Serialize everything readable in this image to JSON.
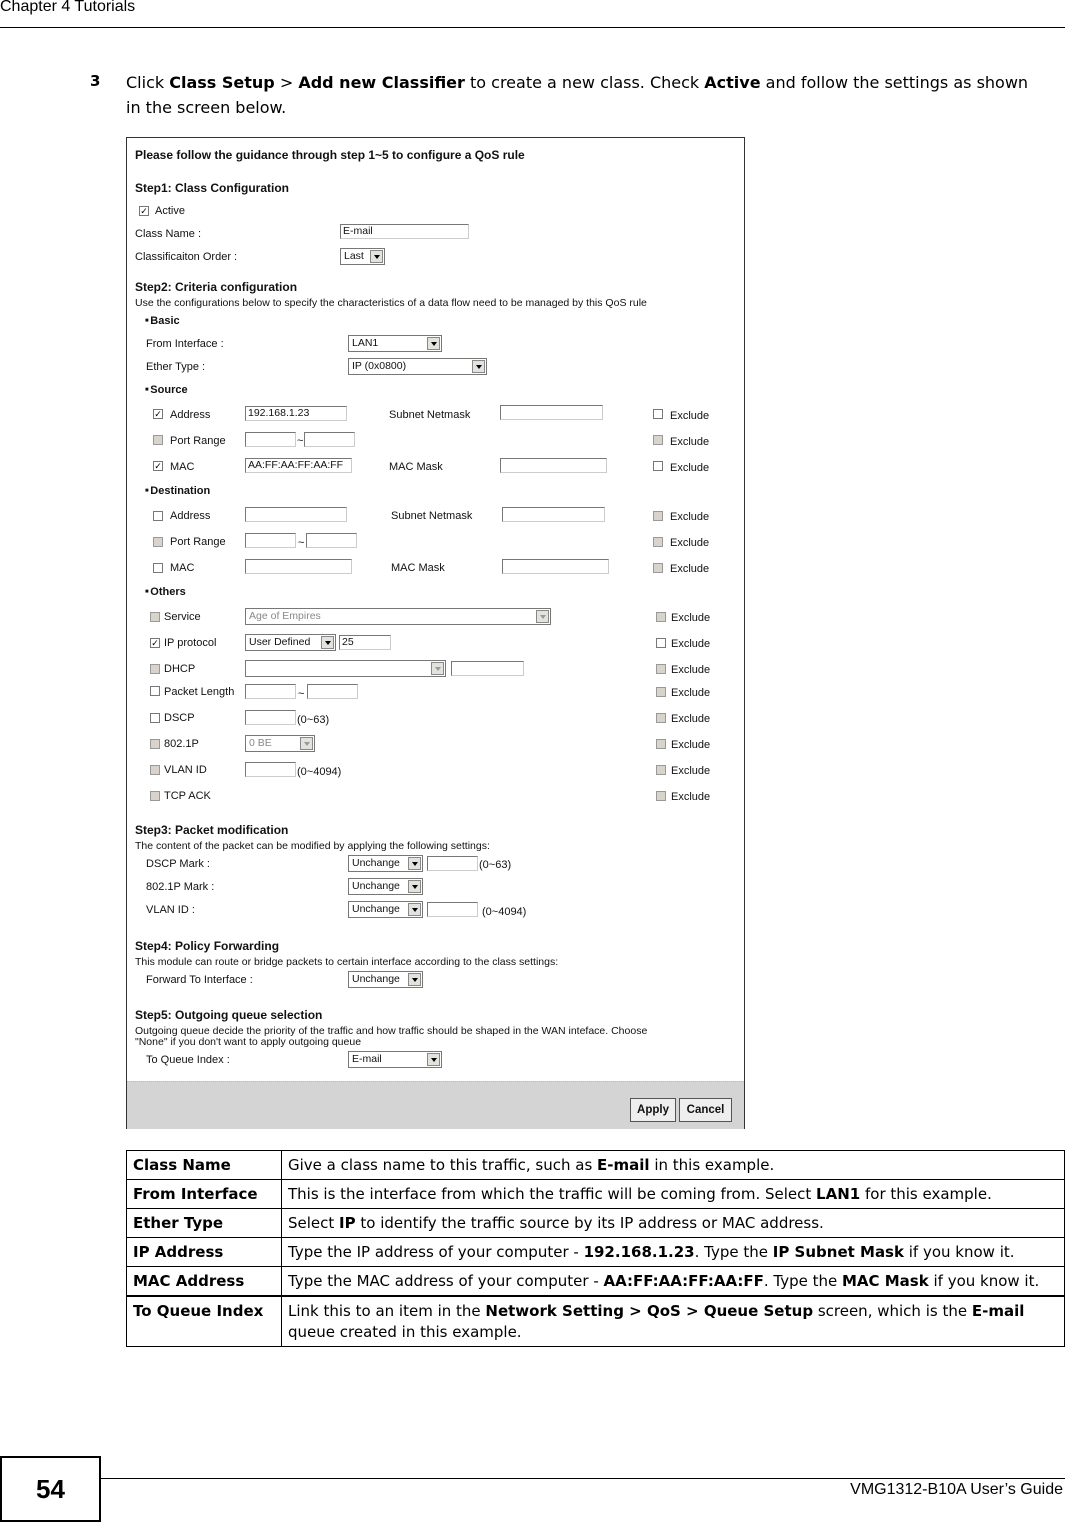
{
  "header": {
    "chapter": "Chapter 4 Tutorials"
  },
  "instruction": {
    "number": "3",
    "parts": [
      {
        "t": "Click ",
        "b": false
      },
      {
        "t": "Class Setup",
        "b": true
      },
      {
        "t": " > ",
        "b": false
      },
      {
        "t": "Add new Classifier",
        "b": true
      },
      {
        "t": " to create a new class. Check ",
        "b": false
      },
      {
        "t": "Active",
        "b": true
      },
      {
        "t": " and follow the settings as shown in the screen below.",
        "b": false
      }
    ]
  },
  "form": {
    "guidance": "Please follow the guidance through step 1~5 to configure a QoS rule",
    "step1": {
      "title": "Step1: Class Configuration",
      "active_label": "Active",
      "active_checked": true,
      "class_name_label": "Class Name :",
      "class_name_value": "E-mail",
      "order_label": "Classificaiton Order :",
      "order_value": "Last"
    },
    "step2": {
      "title": "Step2: Criteria configuration",
      "desc": "Use the configurations below to specify the characteristics of a data flow need to be managed by this QoS rule",
      "basic": {
        "title": "Basic",
        "from_interface_label": "From Interface :",
        "from_interface_value": "LAN1",
        "ether_type_label": "Ether Type :",
        "ether_type_value": "IP (0x0800)"
      },
      "source": {
        "title": "Source",
        "address_label": "Address",
        "address_value": "192.168.1.23",
        "subnet_label": "Subnet Netmask",
        "port_range_label": "Port Range",
        "tilde": "~",
        "mac_label": "MAC",
        "mac_value": "AA:FF:AA:FF:AA:FF",
        "mac_mask_label": "MAC Mask"
      },
      "destination": {
        "title": "Destination",
        "address_label": "Address",
        "subnet_label": "Subnet Netmask",
        "port_range_label": "Port Range",
        "tilde": "~",
        "mac_label": "MAC",
        "mac_mask_label": "MAC Mask"
      },
      "others": {
        "title": "Others",
        "service_label": "Service",
        "service_value": "Age of Empires",
        "ip_protocol_label": "IP protocol",
        "ip_protocol_value": "User Defined",
        "ip_protocol_number": "25",
        "dhcp_label": "DHCP",
        "packet_length_label": "Packet Length",
        "tilde": "~",
        "dscp_label": "DSCP",
        "dscp_range": "(0~63)",
        "dot1p_label": "802.1P",
        "dot1p_value": "0 BE",
        "vlan_label": "VLAN ID",
        "vlan_range": "(0~4094)",
        "tcp_ack_label": "TCP ACK"
      },
      "exclude_label": "Exclude"
    },
    "step3": {
      "title": "Step3: Packet modification",
      "desc": "The content of the packet can be modified by applying the following settings:",
      "dscp_mark_label": "DSCP Mark :",
      "dscp_mark_value": "Unchange",
      "dscp_range": "(0~63)",
      "dot1p_mark_label": "802.1P Mark :",
      "dot1p_mark_value": "Unchange",
      "vlan_label": "VLAN ID :",
      "vlan_value": "Unchange",
      "vlan_range": "(0~4094)"
    },
    "step4": {
      "title": "Step4: Policy Forwarding",
      "desc": "This module can route or bridge packets to certain interface according to the class settings:",
      "forward_label": "Forward To Interface :",
      "forward_value": "Unchange"
    },
    "step5": {
      "title": "Step5: Outgoing queue selection",
      "desc1": "Outgoing queue decide the priority of the traffic and how traffic should be shaped in the WAN inteface. Choose",
      "desc2": "\"None\" if you don't want to apply outgoing queue",
      "queue_label": "To Queue Index :",
      "queue_value": "E-mail"
    },
    "buttons": {
      "apply": "Apply",
      "cancel": "Cancel"
    }
  },
  "table": [
    {
      "key": "Class Name",
      "desc": [
        {
          "t": "Give a class name to this traffic, such as ",
          "b": false
        },
        {
          "t": "E-mail",
          "b": true
        },
        {
          "t": " in this example.",
          "b": false
        }
      ]
    },
    {
      "key": "From Interface",
      "desc": [
        {
          "t": "This is the interface from which the traffic will be coming from. Select ",
          "b": false
        },
        {
          "t": "LAN1",
          "b": true
        },
        {
          "t": " for this example.",
          "b": false
        }
      ]
    },
    {
      "key": "Ether Type",
      "desc": [
        {
          "t": "Select ",
          "b": false
        },
        {
          "t": "IP",
          "b": true
        },
        {
          "t": " to identify the traffic source by its IP address or MAC address.",
          "b": false
        }
      ]
    },
    {
      "key": "IP Address",
      "desc": [
        {
          "t": "Type the IP address of your computer - ",
          "b": false
        },
        {
          "t": "192.168.1.23",
          "b": true
        },
        {
          "t": ". Type the ",
          "b": false
        },
        {
          "t": "IP Subnet Mask",
          "b": true
        },
        {
          "t": " if you know it.",
          "b": false
        }
      ]
    },
    {
      "key": "MAC Address",
      "desc": [
        {
          "t": "Type the MAC address of your computer - ",
          "b": false
        },
        {
          "t": "AA:FF:AA:FF:AA:FF",
          "b": true
        },
        {
          "t": ". Type the ",
          "b": false
        },
        {
          "t": "MAC Mask",
          "b": true
        },
        {
          "t": " if you know it.",
          "b": false
        }
      ]
    },
    {
      "key": "To Queue Index",
      "desc": [
        {
          "t": "Link this to an item in the ",
          "b": false
        },
        {
          "t": "Network Setting > QoS > Queue Setup",
          "b": true
        },
        {
          "t": " screen, which is the ",
          "b": false
        },
        {
          "t": "E-mail",
          "b": true
        },
        {
          "t": " queue created in this example.",
          "b": false
        }
      ]
    }
  ],
  "footer": {
    "page_number": "54",
    "guide": "VMG1312-B10A User’s Guide"
  }
}
